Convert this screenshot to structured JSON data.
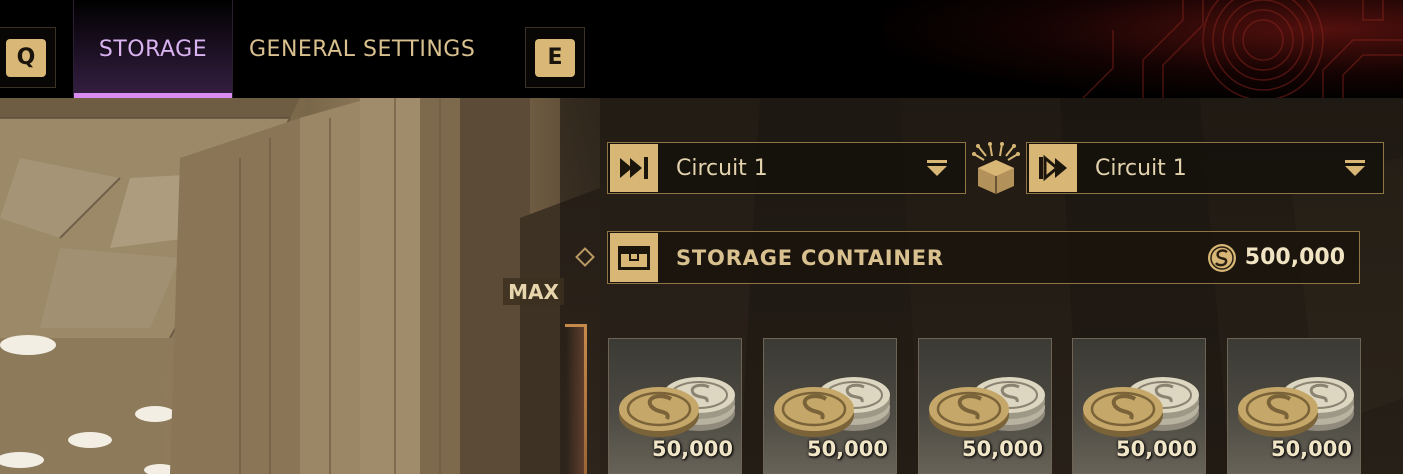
{
  "top_nav": {
    "key_prev": "Q",
    "key_next": "E",
    "tabs": [
      {
        "label": "STORAGE",
        "active": true
      },
      {
        "label": "GENERAL SETTINGS",
        "active": false
      }
    ]
  },
  "circuit": {
    "input": {
      "label": "Circuit 1",
      "icon": "input-arrow-icon"
    },
    "output": {
      "label": "Circuit 1",
      "icon": "output-arrow-icon"
    },
    "link_icon": "circuit-link-icon"
  },
  "storage": {
    "title": "STORAGE CONTAINER",
    "amount": "500,000",
    "currency_icon": "solari-coin-icon"
  },
  "slider": {
    "max_label": "MAX"
  },
  "coin_slots": [
    {
      "amount": "50,000"
    },
    {
      "amount": "50,000"
    },
    {
      "amount": "50,000"
    },
    {
      "amount": "50,000"
    },
    {
      "amount": "50,000"
    }
  ],
  "colors": {
    "accent_gold": "#d7b676",
    "active_tab": "#d98cf0",
    "border": "#8f7446"
  }
}
